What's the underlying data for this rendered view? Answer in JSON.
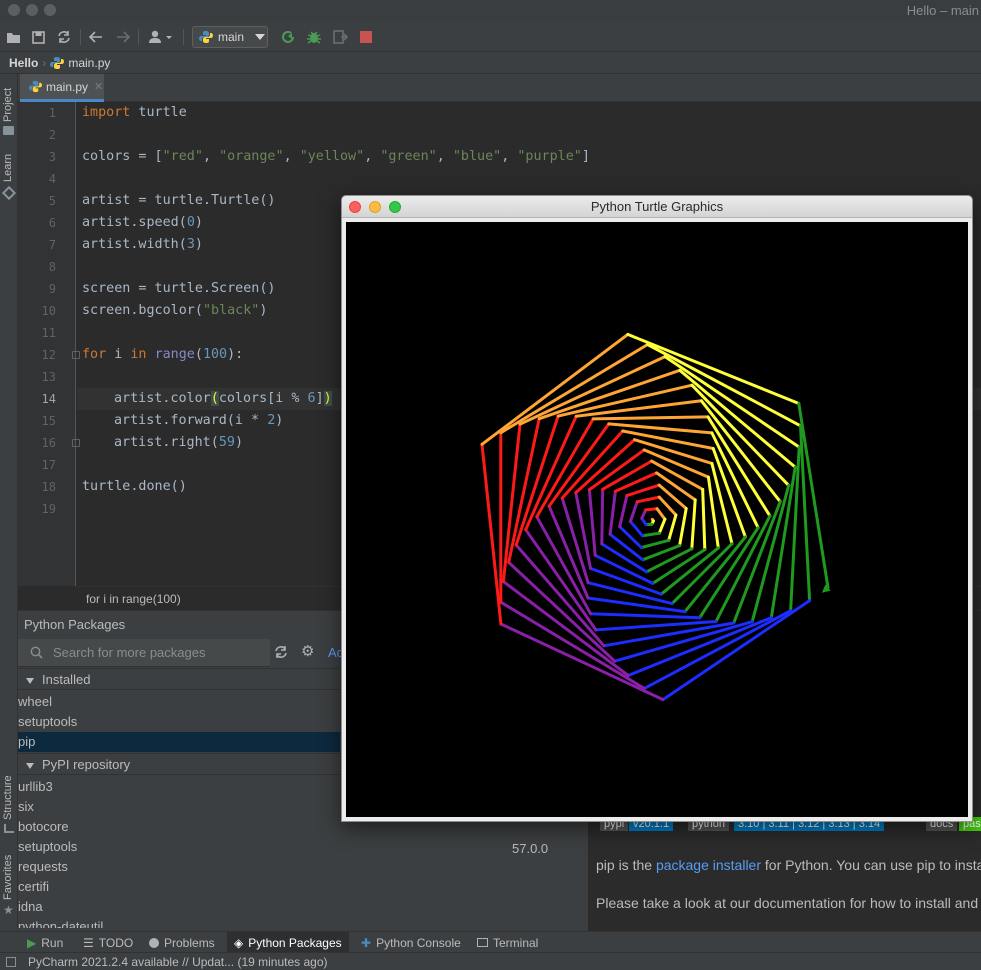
{
  "window": {
    "title": "Hello – main"
  },
  "toolbar": {
    "run_config_label": "main"
  },
  "breadcrumb": {
    "project": "Hello",
    "file": "main.py"
  },
  "left_stripe": {
    "project": "Project",
    "learn": "Learn",
    "structure": "Structure",
    "favorites": "Favorites"
  },
  "editor": {
    "tab_label": "main.py",
    "line_numbers": [
      "1",
      "2",
      "3",
      "4",
      "5",
      "6",
      "7",
      "8",
      "9",
      "10",
      "11",
      "12",
      "13",
      "14",
      "15",
      "16",
      "17",
      "18",
      "19"
    ],
    "current_line": 14,
    "code": {
      "l1_kw": "import",
      "l1_rest": " turtle",
      "l3_a": "colors = [",
      "l3_s1": "\"red\"",
      "l3_s2": "\"orange\"",
      "l3_s3": "\"yellow\"",
      "l3_s4": "\"green\"",
      "l3_s5": "\"blue\"",
      "l3_s6": "\"purple\"",
      "l3_z": "]",
      "l5": "artist = turtle.Turtle()",
      "l6_a": "artist.speed(",
      "l6_n": "0",
      "l6_z": ")",
      "l7_a": "artist.width(",
      "l7_n": "3",
      "l7_z": ")",
      "l9": "screen = turtle.Screen()",
      "l10_a": "screen.bgcolor(",
      "l10_s": "\"black\"",
      "l10_z": ")",
      "l12_kw1": "for",
      "l12_a": " i ",
      "l12_kw2": "in",
      "l12_sp": " ",
      "l12_bi": "range",
      "l12_b": "(",
      "l12_n": "100",
      "l12_z": "):",
      "l14_a": "artist.color",
      "l14_p1": "(",
      "l14_b": "colors[i % ",
      "l14_n": "6",
      "l14_c": "]",
      "l14_p2": ")",
      "l15_a": "artist.forward(i * ",
      "l15_n": "2",
      "l15_z": ")",
      "l16_a": "artist.right(",
      "l16_n": "59",
      "l16_z": ")",
      "l18": "turtle.done()"
    },
    "breadcrumb_text": "for i in range(100)"
  },
  "packages": {
    "title": "Python Packages",
    "search_placeholder": "Search for more packages",
    "add_label": "Ad",
    "installed_header": "Installed",
    "installed": [
      "wheel",
      "setuptools",
      "pip"
    ],
    "selected": "pip",
    "repo_header": "PyPI repository",
    "repo": [
      "urllib3",
      "six",
      "botocore",
      "setuptools",
      "requests",
      "certifi",
      "idna",
      "python-dateutil"
    ],
    "repo_version": "57.0.0",
    "detail": {
      "badge_pypi": "pypi",
      "badge_version": "v20.1.1",
      "badge_python": "python",
      "badge_versions": "3.10 | 3.11 | 3.12 | 3.13 | 3.14",
      "badge_docs": "docs",
      "badge_docs_status": "pas",
      "p1_a": "pip is the ",
      "p1_link": "package installer",
      "p1_b": " for Python. You can use pip to insta",
      "p2": "Please take a look at our documentation for how to install and"
    }
  },
  "bottom_tabs": [
    "Run",
    "TODO",
    "Problems",
    "Python Packages",
    "Python Console",
    "Terminal"
  ],
  "active_bottom_tab": "Python Packages",
  "status": {
    "text": "PyCharm 2021.2.4 available // Updat... (19 minutes ago)"
  },
  "turtle_window": {
    "title": "Python Turtle Graphics",
    "program": {
      "colors": [
        "red",
        "orange",
        "yellow",
        "green",
        "blue",
        "purple"
      ],
      "iterations": 100,
      "step_multiplier": 2,
      "turn_degrees": 59,
      "pen_width": 3,
      "background": "#000000"
    }
  },
  "colors": {
    "accent": "#4a88c7",
    "keyword": "#cc7832",
    "string": "#6a8759",
    "number": "#6897bb",
    "builtin": "#8888c6"
  }
}
